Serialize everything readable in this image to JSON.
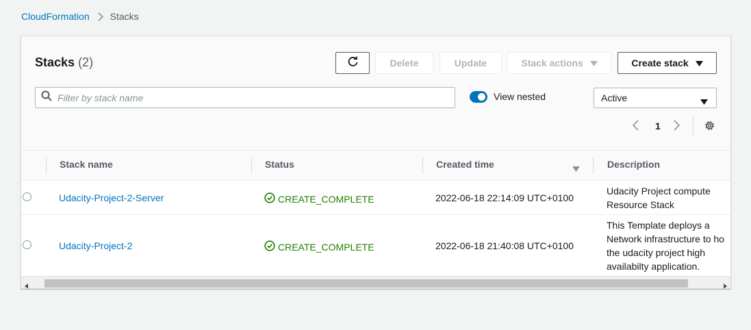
{
  "breadcrumb": {
    "root": "CloudFormation",
    "current": "Stacks"
  },
  "header": {
    "title": "Stacks",
    "count": "(2)"
  },
  "toolbar": {
    "delete_label": "Delete",
    "update_label": "Update",
    "actions_label": "Stack actions",
    "create_label": "Create stack"
  },
  "search": {
    "placeholder": "Filter by stack name",
    "value": ""
  },
  "view_nested": {
    "label": "View nested",
    "enabled": true
  },
  "filter_select": {
    "value": "Active"
  },
  "pagination": {
    "page": "1"
  },
  "table": {
    "columns": [
      "Stack name",
      "Status",
      "Created time",
      "Description"
    ],
    "rows": [
      {
        "name": "Udacity-Project-2-Server",
        "status": "CREATE_COMPLETE",
        "created": "2022-06-18 22:14:09 UTC+0100",
        "description": [
          "Udacity Project compute",
          "Resource Stack"
        ]
      },
      {
        "name": "Udacity-Project-2",
        "status": "CREATE_COMPLETE",
        "created": "2022-06-18 21:40:08 UTC+0100",
        "description": [
          "This Template deploys a",
          "Network infrastructure to ho",
          "the udacity project high",
          "availabilty application."
        ]
      }
    ]
  },
  "colors": {
    "link": "#0073bb",
    "success": "#1d8102",
    "toggle": "#0073bb"
  }
}
